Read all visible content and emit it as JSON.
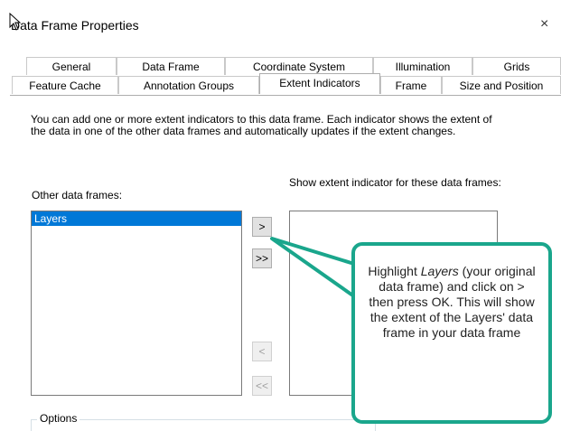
{
  "window": {
    "title": "Data Frame Properties",
    "close_glyph": "×"
  },
  "tabs": {
    "row1": [
      "General",
      "Data Frame",
      "Coordinate System",
      "Illumination",
      "Grids"
    ],
    "row2": [
      "Feature Cache",
      "Annotation Groups",
      "Extent Indicators",
      "Frame",
      "Size and Position"
    ],
    "active": "Extent Indicators"
  },
  "description": "You can add one or more extent indicators to this data frame.  Each indicator shows the extent of the data in one of the other data frames and automatically updates if the extent changes.",
  "other_frames": {
    "label": "Other data frames:",
    "items": [
      "Layers"
    ],
    "selected": "Layers"
  },
  "show_extent": {
    "label": "Show extent indicator for these data frames:",
    "items": []
  },
  "buttons": {
    "add": ">",
    "add_all": ">>",
    "remove": "<",
    "remove_all": "<<"
  },
  "options_group": {
    "label": "Options"
  },
  "callout": {
    "line1_prefix": "Highlight ",
    "line1_italic": "Layers",
    "line1_suffix": " (your original data frame) and click on > then press OK. This will show the extent of the Layers' data frame in your data frame"
  },
  "colors": {
    "callout_border": "#1aa68c",
    "selection": "#0078d7"
  },
  "icons": {
    "cursor": "pointer-cursor-icon",
    "close": "close-icon"
  }
}
